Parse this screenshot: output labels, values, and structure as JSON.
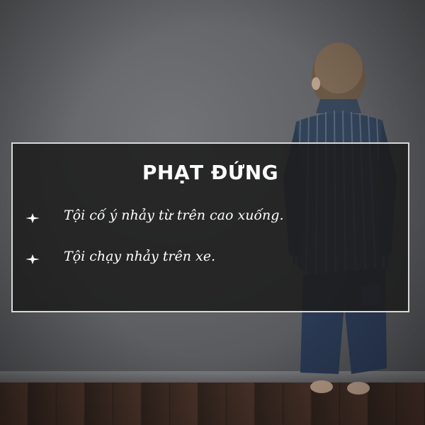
{
  "panel": {
    "title": "PHẠT ĐỨNG",
    "items": [
      {
        "text": "Tội cố ý nhảy từ trên cao xuống."
      },
      {
        "text": "Tội chạy nhảy trên xe."
      }
    ]
  },
  "icons": {
    "bullet": "four-point-star-bullet-icon"
  },
  "colors": {
    "panel_background": "#1c1c1c",
    "panel_border": "#d8d8d8",
    "text": "#ffffff",
    "wall": "#5e5f62",
    "floor": "#3b2a22"
  }
}
